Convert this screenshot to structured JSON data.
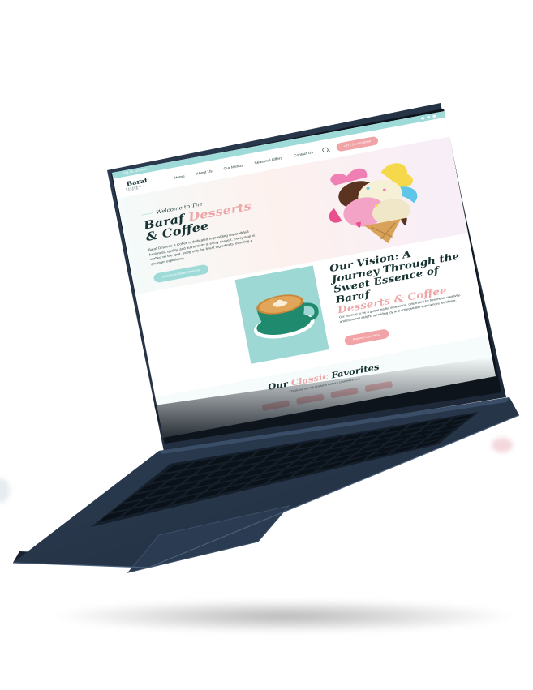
{
  "site": {
    "topbar": {
      "phone": "+971 55 410 0000"
    },
    "logo": {
      "name": "Baraf",
      "tagline": "DESSERTS & COFFEE"
    },
    "nav": {
      "items": [
        "Home",
        "About Us",
        "Our Menus",
        "Seasonal Offers",
        "Contact Us"
      ],
      "phone_button": "+971 55 410 0000"
    },
    "hero": {
      "welcome": "Welcome to The",
      "title_part1": "Baraf",
      "title_accent": "Desserts",
      "title_part2": "& Coffee",
      "description": "Baraf Desserts & Coffee is dedicated to providing unparalleled freshness, quality, and authenticity in every dessert. Every treat is crafted on the spot, using only the finest ingredients, ensuring a premium experience.",
      "cta": "Indulge in Sweet Delights"
    },
    "vision": {
      "title": "Our Vision: A Journey Through the Sweet Essence of Baraf",
      "title_accent": "Desserts & Coffee",
      "description": "Our vision is to be a global leader in desserts, celebrated for freshness, creativity, and customer delight, spreading joy and unforgettable experiences worldwide.",
      "cta": "Explore Our Menu"
    },
    "favorites": {
      "title_part1": "Our",
      "title_accent": "Classic",
      "title_part2": "Favorites",
      "subtitle": "Check out our top products that our customers love."
    }
  },
  "colors": {
    "brand_teal": "#9edbd8",
    "brand_pink": "#f1a3a6",
    "ink": "#163331",
    "device_body": "#27364a"
  },
  "icons": [
    "search-icon",
    "social-icons",
    "arrow-right-icon"
  ]
}
